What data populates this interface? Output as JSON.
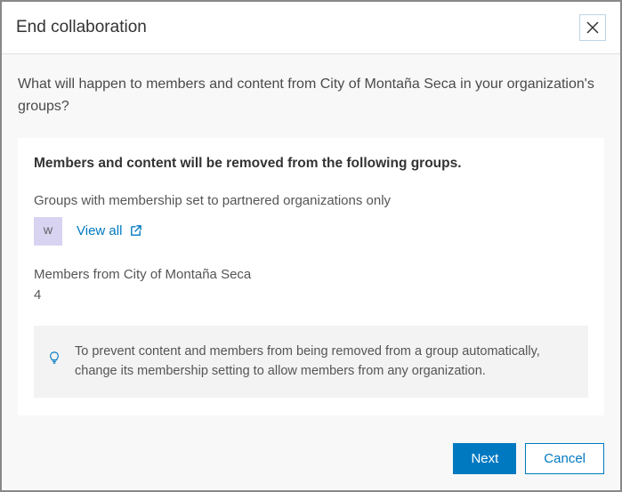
{
  "header": {
    "title": "End collaboration"
  },
  "intro": "What will happen to members and content from City of Montaña Seca in your organization's groups?",
  "panel": {
    "heading": "Members and content will be removed from the following groups.",
    "groups_label": "Groups with membership set to partnered organizations only",
    "group_avatar_text": "W",
    "view_all_label": "View all",
    "members_label": "Members from City of Montaña Seca",
    "members_count": "4",
    "tip_text": "To prevent content and members from being removed from a group automatically, change its membership setting to allow members from any organization."
  },
  "footer": {
    "next_label": "Next",
    "cancel_label": "Cancel"
  }
}
